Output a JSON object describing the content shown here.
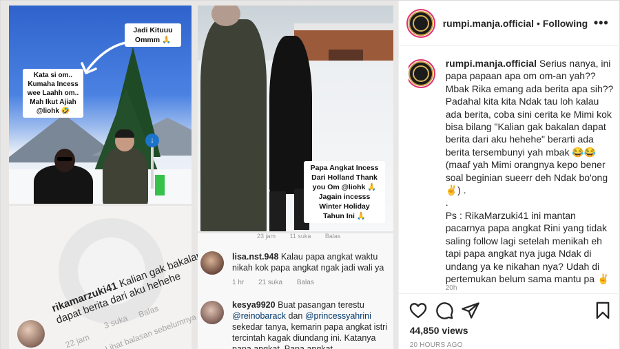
{
  "header": {
    "username": "rumpi.manja.official",
    "separator": "•",
    "follow_status": "Following",
    "more": "•••"
  },
  "caption": {
    "username": "rumpi.manja.official",
    "text": "Serius nanya, ini papa papaan apa om om-an yah?? Mbak Rika emang ada berita apa sih?? Padahal kita kita Ndak tau loh kalau ada berita, coba sini cerita ke Mimi kok bisa bilang \"Kalian gak bakalan dapat berita dari aku hehehe\" berarti ada berita tersembunyi yah mbak 😂😂 (maaf yah Mimi orangnya kepo bener soal beginian sueerr deh Ndak bo'ong ✌️) .",
    "dot": ".",
    "ps": "Ps : RikaMarzuki41 ini mantan pacarnya papa angkat Rini yang tidak saling follow lagi setelah menikah eh tapi papa angkat nya juga Ndak di undang ya ke nikahan nya? Udah di pertemukan belum sama mantu pa ✌️",
    "time": "20h"
  },
  "actions": {
    "views": "44,850 views",
    "ago": "20 HOURS AGO"
  },
  "media": {
    "bubble_top": "Jadi Kituuu Ommm 🙏",
    "bubble_left": "Kata si om.. Kumaha Incess wee Laahh om.. Mah Ikut Ajiah @liohk 🤣",
    "bubble_right": "Papa Angkat Incess Dari Holland Thank you Om @liohk 🙏 Jagain incesss Winter Holiday Tahun Ini 🙏",
    "rot_comment_user": "rikamarzuki41",
    "rot_comment_text": "Kalian gak bakalan dapat berita dari aku hehehe",
    "rot_time": "22 jam",
    "rot_likes": "3 suka",
    "rot_reply": "Balas",
    "rot_more": "Lihat balasan sebelumnya",
    "top_meta_time": "23 jam",
    "top_meta_likes": "11 suka",
    "top_meta_reply": "Balas",
    "comment1_user": "lisa.nst.948",
    "comment1_text": "Kalau papa angkat waktu nikah kok papa angkat ngak jadi wali ya",
    "comment1_time": "1 hr",
    "comment1_likes": "21 suka",
    "comment1_reply": "Balas",
    "comment2_user": "kesya9920",
    "comment2_text_a": "Buat pasangan terestu",
    "comment2_mention1": "@reinobarack",
    "comment2_and": "dan",
    "comment2_mention2": "@princessyahrini",
    "comment2_text_b": "sekedar tanya, kemarin papa angkat istri tercintah kagak diundang ini. Katanya papa angkat. Papa angkat"
  }
}
